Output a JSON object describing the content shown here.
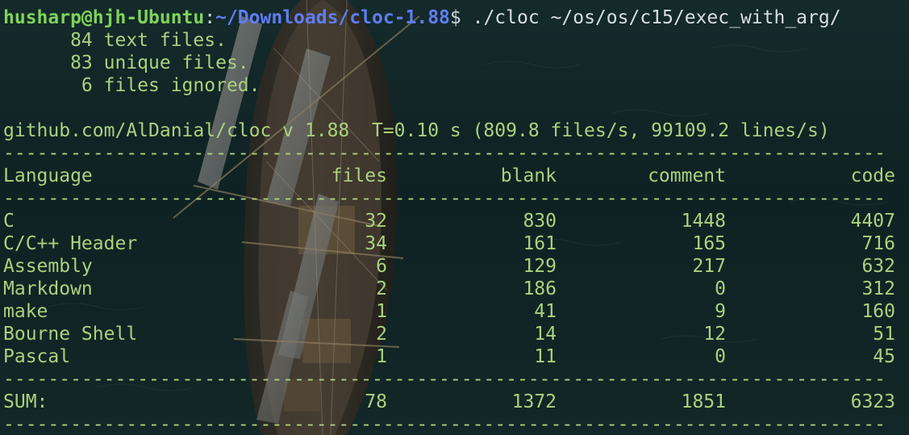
{
  "prompt": {
    "user_host": "husharp@hjh-Ubuntu",
    "sep": ":",
    "path": "~/Downloads/cloc-1.88",
    "symbol": "$",
    "command": " ./cloc ~/os/os/c15/exec_with_arg/"
  },
  "summary": {
    "text_files": "      84 text files.",
    "unique_files": "      83 unique files.",
    "ignored": "       6 files ignored."
  },
  "version_line": "github.com/AlDanial/cloc v 1.88  T=0.10 s (809.8 files/s, 99109.2 lines/s)",
  "separator": "-------------------------------------------------------------------------------",
  "header": {
    "language": "Language",
    "files": "files",
    "blank": "blank",
    "comment": "comment",
    "code": "code"
  },
  "rows": [
    {
      "language": "C",
      "files": "32",
      "blank": "830",
      "comment": "1448",
      "code": "4407"
    },
    {
      "language": "C/C++ Header",
      "files": "34",
      "blank": "161",
      "comment": "165",
      "code": "716"
    },
    {
      "language": "Assembly",
      "files": "6",
      "blank": "129",
      "comment": "217",
      "code": "632"
    },
    {
      "language": "Markdown",
      "files": "2",
      "blank": "186",
      "comment": "0",
      "code": "312"
    },
    {
      "language": "make",
      "files": "1",
      "blank": "41",
      "comment": "9",
      "code": "160"
    },
    {
      "language": "Bourne Shell",
      "files": "2",
      "blank": "14",
      "comment": "12",
      "code": "51"
    },
    {
      "language": "Pascal",
      "files": "1",
      "blank": "11",
      "comment": "0",
      "code": "45"
    }
  ],
  "sum": {
    "language": "SUM:",
    "files": "78",
    "blank": "1372",
    "comment": "1851",
    "code": "6323"
  },
  "colors": {
    "background": "#132424",
    "output_text": "#a9d27d",
    "prompt_user": "#7fd35a",
    "prompt_path": "#5f7df2",
    "command_text": "#d9dee0"
  }
}
